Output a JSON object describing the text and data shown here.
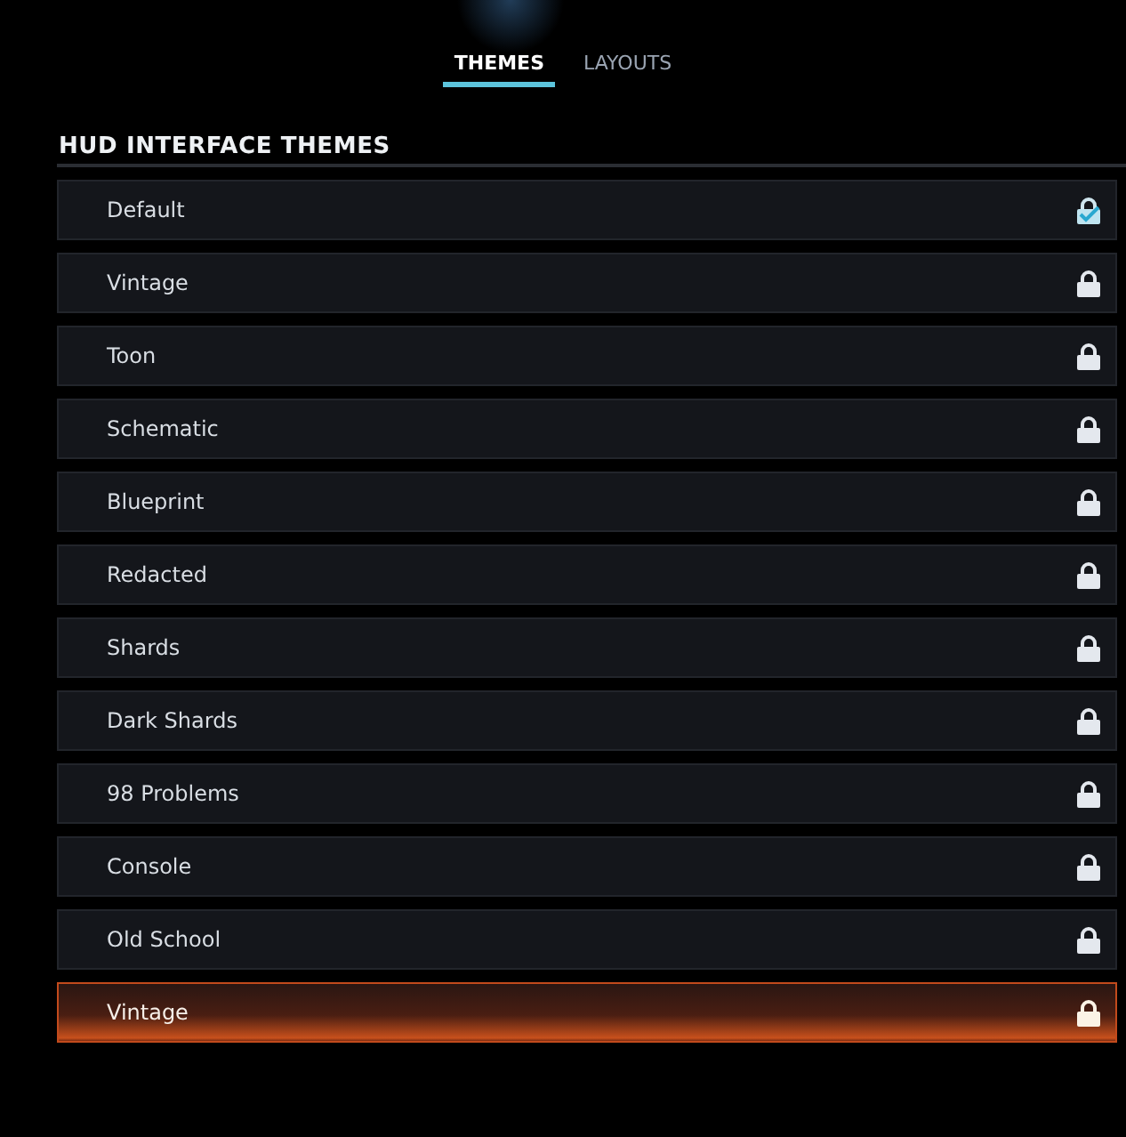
{
  "tabs": [
    {
      "label": "THEMES",
      "selected": true
    },
    {
      "label": "LAYOUTS",
      "selected": false
    }
  ],
  "section": {
    "title": "HUD INTERFACE THEMES"
  },
  "themes": [
    {
      "label": "Default",
      "equipped": true,
      "selected": false
    },
    {
      "label": "Vintage",
      "equipped": false,
      "selected": false
    },
    {
      "label": "Toon",
      "equipped": false,
      "selected": false
    },
    {
      "label": "Schematic",
      "equipped": false,
      "selected": false
    },
    {
      "label": "Blueprint",
      "equipped": false,
      "selected": false
    },
    {
      "label": "Redacted",
      "equipped": false,
      "selected": false
    },
    {
      "label": "Shards",
      "equipped": false,
      "selected": false
    },
    {
      "label": "Dark Shards",
      "equipped": false,
      "selected": false
    },
    {
      "label": "98 Problems",
      "equipped": false,
      "selected": false
    },
    {
      "label": "Console",
      "equipped": false,
      "selected": false
    },
    {
      "label": "Old School",
      "equipped": false,
      "selected": false
    },
    {
      "label": "Vintage",
      "equipped": false,
      "selected": true
    }
  ]
}
